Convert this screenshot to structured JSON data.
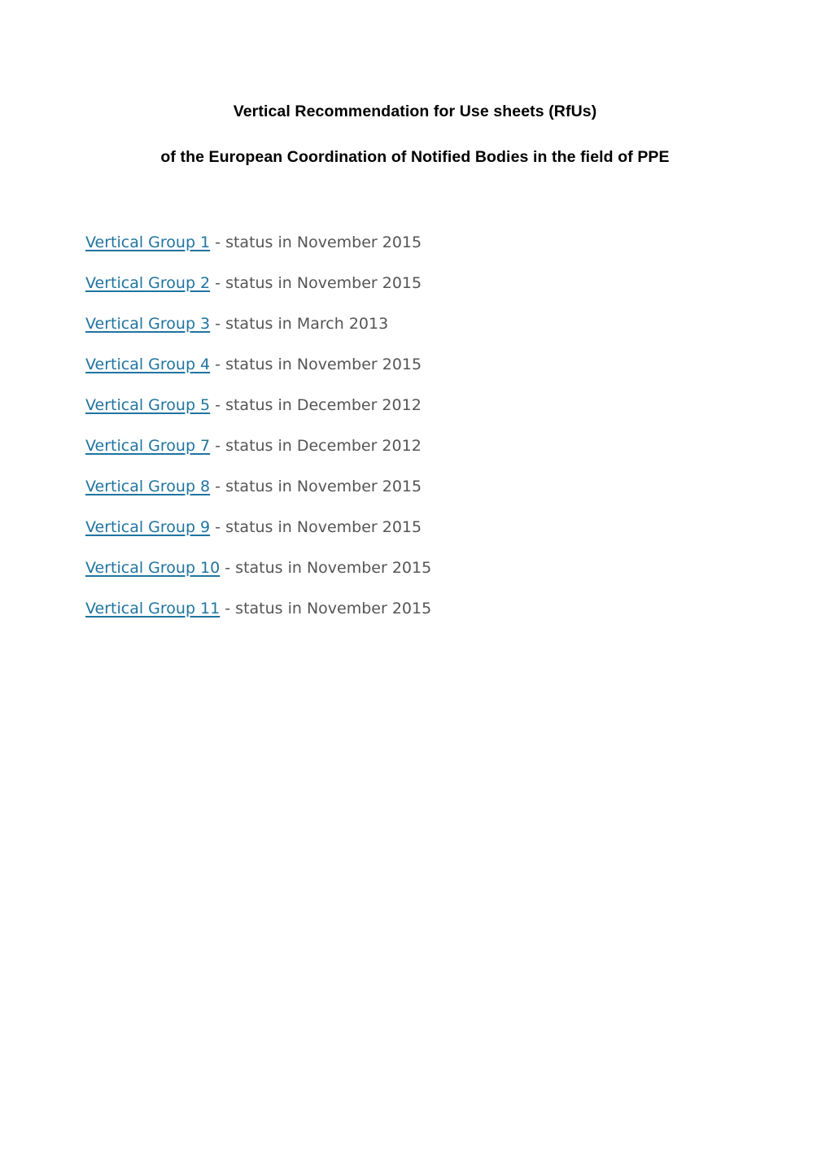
{
  "document": {
    "title_line_1": "Vertical Recommendation for Use sheets (RfUs)",
    "title_line_2": "of the European Coordination of Notified Bodies in the field of PPE",
    "link_color": "#1f74a0",
    "text_color": "#555555",
    "title_color": "#000000",
    "background_color": "#ffffff"
  },
  "entries": [
    {
      "link_label": "Vertical Group 1",
      "status_text": " - status in November 2015"
    },
    {
      "link_label": "Vertical Group 2",
      "status_text": " - status in November 2015"
    },
    {
      "link_label": "Vertical Group 3",
      "status_text": " - status in March 2013"
    },
    {
      "link_label": "Vertical Group 4",
      "status_text": " - status in November 2015"
    },
    {
      "link_label": "Vertical Group 5",
      "status_text": " - status in December 2012"
    },
    {
      "link_label": "Vertical Group 7",
      "status_text": " - status in December 2012"
    },
    {
      "link_label": "Vertical Group 8",
      "status_text": " - status in November 2015"
    },
    {
      "link_label": "Vertical Group 9",
      "status_text": " - status in November 2015"
    },
    {
      "link_label": "Vertical Group 10",
      "status_text": " - status in November 2015"
    },
    {
      "link_label": "Vertical Group 11",
      "status_text": " - status in November 2015"
    }
  ]
}
